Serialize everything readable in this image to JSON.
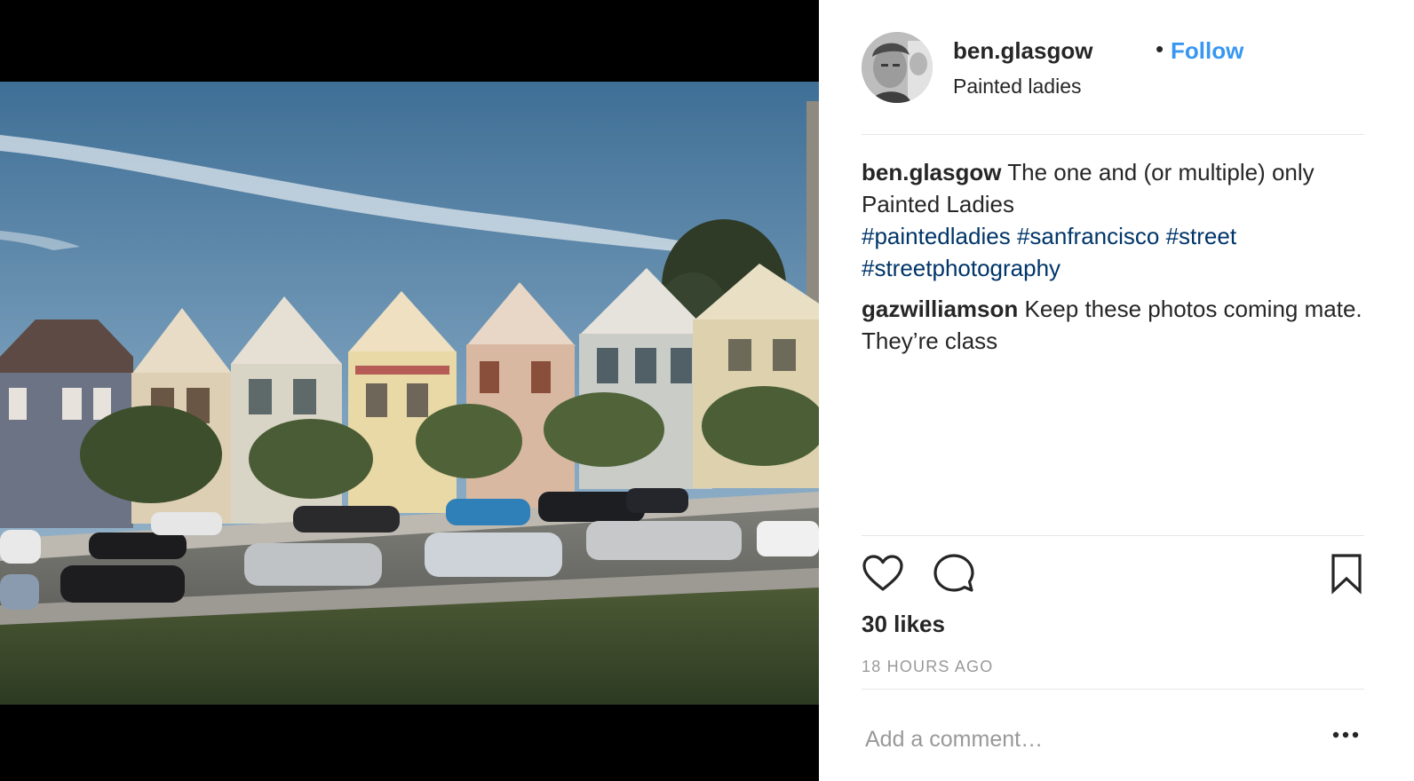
{
  "post": {
    "photo_alt": "Painted Ladies Victorian houses with cars parked on the street",
    "header": {
      "username": "ben.glasgow",
      "separator": "•",
      "follow_label": "Follow",
      "location": "Painted ladies"
    },
    "caption": {
      "username": "ben.glasgow",
      "text": "The one and (or multiple) only Painted Ladies",
      "hashtags": [
        "#paintedladies",
        "#sanfrancisco",
        "#street",
        "#streetphotography"
      ]
    },
    "comments": [
      {
        "username": "gazwilliamson",
        "text": "Keep these photos coming mate. They’re class"
      }
    ],
    "actions": {
      "like_icon": "heart-outline-icon",
      "comment_icon": "speech-bubble-icon",
      "save_icon": "bookmark-outline-icon"
    },
    "likes": "30 likes",
    "timestamp": "18 HOURS AGO",
    "comment_input": {
      "placeholder": "Add a comment…",
      "value": ""
    },
    "more_icon": "more-options-icon"
  },
  "colors": {
    "follow": "#3897f0",
    "hashtag": "#003569",
    "muted": "#999999",
    "text": "#262626",
    "divider": "#e6e6e6"
  }
}
